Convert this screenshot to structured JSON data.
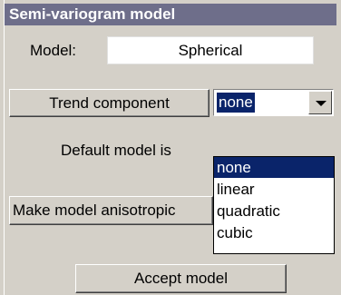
{
  "panel": {
    "title": "Semi-variogram model"
  },
  "model": {
    "label": "Model:",
    "value": "Spherical"
  },
  "trend": {
    "button_label": "Trend component",
    "selected": "none",
    "options": [
      "none",
      "linear",
      "quadratic",
      "cubic"
    ]
  },
  "default_text": "Default model is",
  "anisotropic_button": "Make model anisotropic",
  "accept_button": "Accept model",
  "colors": {
    "header_bg": "#6e6e8a",
    "selection_bg": "#0a246a",
    "window_bg": "#d4d0c8"
  }
}
